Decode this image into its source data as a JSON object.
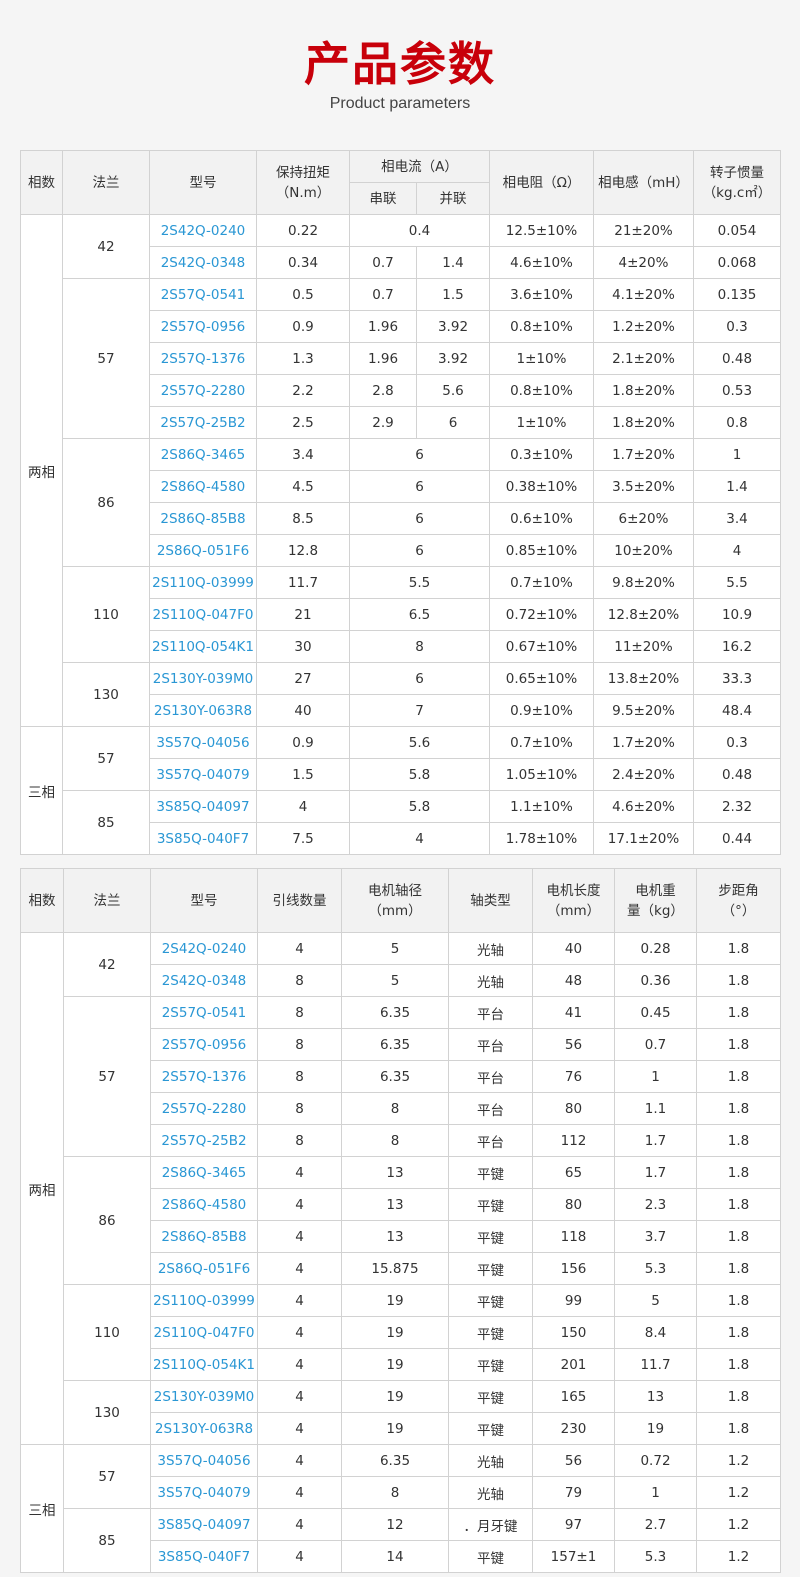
{
  "header": {
    "title": "产品参数",
    "subtitle": "Product parameters"
  },
  "table1": {
    "headers": {
      "phase": "相数",
      "flange": "法兰",
      "model": "型号",
      "torque": "保持扭矩\n（N.m）",
      "current": "相电流（A）",
      "series": "串联",
      "parallel": "并联",
      "resistance": "相电阻（Ω）",
      "inductance": "相电感（mH）",
      "inertia": "转子惯量\n（kg.c㎡）"
    },
    "groups": [
      {
        "phase": "两相",
        "flanges": [
          {
            "flange": "42",
            "rows": [
              {
                "model": "2S42Q-0240",
                "torque": "0.22",
                "current": "0.4",
                "resistance": "12.5±10%",
                "inductance": "21±20%",
                "inertia": "0.054"
              },
              {
                "model": "2S42Q-0348",
                "torque": "0.34",
                "series": "0.7",
                "parallel": "1.4",
                "resistance": "4.6±10%",
                "inductance": "4±20%",
                "inertia": "0.068"
              }
            ]
          },
          {
            "flange": "57",
            "rows": [
              {
                "model": "2S57Q-0541",
                "torque": "0.5",
                "series": "0.7",
                "parallel": "1.5",
                "resistance": "3.6±10%",
                "inductance": "4.1±20%",
                "inertia": "0.135"
              },
              {
                "model": "2S57Q-0956",
                "torque": "0.9",
                "series": "1.96",
                "parallel": "3.92",
                "resistance": "0.8±10%",
                "inductance": "1.2±20%",
                "inertia": "0.3"
              },
              {
                "model": "2S57Q-1376",
                "torque": "1.3",
                "series": "1.96",
                "parallel": "3.92",
                "resistance": "1±10%",
                "inductance": "2.1±20%",
                "inertia": "0.48"
              },
              {
                "model": "2S57Q-2280",
                "torque": "2.2",
                "series": "2.8",
                "parallel": "5.6",
                "resistance": "0.8±10%",
                "inductance": "1.8±20%",
                "inertia": "0.53"
              },
              {
                "model": "2S57Q-25B2",
                "torque": "2.5",
                "series": "2.9",
                "parallel": "6",
                "resistance": "1±10%",
                "inductance": "1.8±20%",
                "inertia": "0.8"
              }
            ]
          },
          {
            "flange": "86",
            "rows": [
              {
                "model": "2S86Q-3465",
                "torque": "3.4",
                "current": "6",
                "resistance": "0.3±10%",
                "inductance": "1.7±20%",
                "inertia": "1"
              },
              {
                "model": "2S86Q-4580",
                "torque": "4.5",
                "current": "6",
                "resistance": "0.38±10%",
                "inductance": "3.5±20%",
                "inertia": "1.4"
              },
              {
                "model": "2S86Q-85B8",
                "torque": "8.5",
                "current": "6",
                "resistance": "0.6±10%",
                "inductance": "6±20%",
                "inertia": "3.4"
              },
              {
                "model": "2S86Q-051F6",
                "torque": "12.8",
                "current": "6",
                "resistance": "0.85±10%",
                "inductance": "10±20%",
                "inertia": "4"
              }
            ]
          },
          {
            "flange": "110",
            "rows": [
              {
                "model": "2S110Q-03999",
                "torque": "11.7",
                "current": "5.5",
                "resistance": "0.7±10%",
                "inductance": "9.8±20%",
                "inertia": "5.5"
              },
              {
                "model": "2S110Q-047F0",
                "torque": "21",
                "current": "6.5",
                "resistance": "0.72±10%",
                "inductance": "12.8±20%",
                "inertia": "10.9"
              },
              {
                "model": "2S110Q-054K1",
                "torque": "30",
                "current": "8",
                "resistance": "0.67±10%",
                "inductance": "11±20%",
                "inertia": "16.2"
              }
            ]
          },
          {
            "flange": "130",
            "rows": [
              {
                "model": "2S130Y-039M0",
                "torque": "27",
                "current": "6",
                "resistance": "0.65±10%",
                "inductance": "13.8±20%",
                "inertia": "33.3"
              },
              {
                "model": "2S130Y-063R8",
                "torque": "40",
                "current": "7",
                "resistance": "0.9±10%",
                "inductance": "9.5±20%",
                "inertia": "48.4"
              }
            ]
          }
        ]
      },
      {
        "phase": "三相",
        "flanges": [
          {
            "flange": "57",
            "rows": [
              {
                "model": "3S57Q-04056",
                "torque": "0.9",
                "current": "5.6",
                "resistance": "0.7±10%",
                "inductance": "1.7±20%",
                "inertia": "0.3"
              },
              {
                "model": "3S57Q-04079",
                "torque": "1.5",
                "current": "5.8",
                "resistance": "1.05±10%",
                "inductance": "2.4±20%",
                "inertia": "0.48"
              }
            ]
          },
          {
            "flange": "85",
            "rows": [
              {
                "model": "3S85Q-04097",
                "torque": "4",
                "current": "5.8",
                "resistance": "1.1±10%",
                "inductance": "4.6±20%",
                "inertia": "2.32"
              },
              {
                "model": "3S85Q-040F7",
                "torque": "7.5",
                "current": "4",
                "resistance": "1.78±10%",
                "inductance": "17.1±20%",
                "inertia": "0.44"
              }
            ]
          }
        ]
      }
    ]
  },
  "table2": {
    "headers": {
      "phase": "相数",
      "flange": "法兰",
      "model": "型号",
      "leads": "引线数量",
      "shaft_dia": "电机轴径\n（mm）",
      "shaft_type": "轴类型",
      "length": "电机长度\n（mm）",
      "weight": "电机重\n量（kg）",
      "step": "步距角\n（°）"
    },
    "groups": [
      {
        "phase": "两相",
        "flanges": [
          {
            "flange": "42",
            "rows": [
              {
                "model": "2S42Q-0240",
                "leads": "4",
                "shaft_dia": "5",
                "shaft_type": "光轴",
                "length": "40",
                "weight": "0.28",
                "step": "1.8"
              },
              {
                "model": "2S42Q-0348",
                "leads": "8",
                "shaft_dia": "5",
                "shaft_type": "光轴",
                "length": "48",
                "weight": "0.36",
                "step": "1.8"
              }
            ]
          },
          {
            "flange": "57",
            "rows": [
              {
                "model": "2S57Q-0541",
                "leads": "8",
                "shaft_dia": "6.35",
                "shaft_type": "平台",
                "length": "41",
                "weight": "0.45",
                "step": "1.8"
              },
              {
                "model": "2S57Q-0956",
                "leads": "8",
                "shaft_dia": "6.35",
                "shaft_type": "平台",
                "length": "56",
                "weight": "0.7",
                "step": "1.8"
              },
              {
                "model": "2S57Q-1376",
                "leads": "8",
                "shaft_dia": "6.35",
                "shaft_type": "平台",
                "length": "76",
                "weight": "1",
                "step": "1.8"
              },
              {
                "model": "2S57Q-2280",
                "leads": "8",
                "shaft_dia": "8",
                "shaft_type": "平台",
                "length": "80",
                "weight": "1.1",
                "step": "1.8"
              },
              {
                "model": "2S57Q-25B2",
                "leads": "8",
                "shaft_dia": "8",
                "shaft_type": "平台",
                "length": "112",
                "weight": "1.7",
                "step": "1.8"
              }
            ]
          },
          {
            "flange": "86",
            "rows": [
              {
                "model": "2S86Q-3465",
                "leads": "4",
                "shaft_dia": "13",
                "shaft_type": "平键",
                "length": "65",
                "weight": "1.7",
                "step": "1.8"
              },
              {
                "model": "2S86Q-4580",
                "leads": "4",
                "shaft_dia": "13",
                "shaft_type": "平键",
                "length": "80",
                "weight": "2.3",
                "step": "1.8"
              },
              {
                "model": "2S86Q-85B8",
                "leads": "4",
                "shaft_dia": "13",
                "shaft_type": "平键",
                "length": "118",
                "weight": "3.7",
                "step": "1.8"
              },
              {
                "model": "2S86Q-051F6",
                "leads": "4",
                "shaft_dia": "15.875",
                "shaft_type": "平键",
                "length": "156",
                "weight": "5.3",
                "step": "1.8"
              }
            ]
          },
          {
            "flange": "110",
            "rows": [
              {
                "model": "2S110Q-03999",
                "leads": "4",
                "shaft_dia": "19",
                "shaft_type": "平键",
                "length": "99",
                "weight": "5",
                "step": "1.8"
              },
              {
                "model": "2S110Q-047F0",
                "leads": "4",
                "shaft_dia": "19",
                "shaft_type": "平键",
                "length": "150",
                "weight": "8.4",
                "step": "1.8"
              },
              {
                "model": "2S110Q-054K1",
                "leads": "4",
                "shaft_dia": "19",
                "shaft_type": "平键",
                "length": "201",
                "weight": "11.7",
                "step": "1.8"
              }
            ]
          },
          {
            "flange": "130",
            "rows": [
              {
                "model": "2S130Y-039M0",
                "leads": "4",
                "shaft_dia": "19",
                "shaft_type": "平键",
                "length": "165",
                "weight": "13",
                "step": "1.8"
              },
              {
                "model": "2S130Y-063R8",
                "leads": "4",
                "shaft_dia": "19",
                "shaft_type": "平键",
                "length": "230",
                "weight": "19",
                "step": "1.8"
              }
            ]
          }
        ]
      },
      {
        "phase": "三相",
        "flanges": [
          {
            "flange": "57",
            "rows": [
              {
                "model": "3S57Q-04056",
                "leads": "4",
                "shaft_dia": "6.35",
                "shaft_type": "光轴",
                "length": "56",
                "weight": "0.72",
                "step": "1.2"
              },
              {
                "model": "3S57Q-04079",
                "leads": "4",
                "shaft_dia": "8",
                "shaft_type": "光轴",
                "length": "79",
                "weight": "1",
                "step": "1.2"
              }
            ]
          },
          {
            "flange": "85",
            "rows": [
              {
                "model": "3S85Q-04097",
                "leads": "4",
                "shaft_dia": "12",
                "shaft_type": "．月牙键",
                "length": "97",
                "weight": "2.7",
                "step": "1.2"
              },
              {
                "model": "3S85Q-040F7",
                "leads": "4",
                "shaft_dia": "14",
                "shaft_type": "平键",
                "length": "157±1",
                "weight": "5.3",
                "step": "1.2"
              }
            ]
          }
        ]
      }
    ]
  }
}
